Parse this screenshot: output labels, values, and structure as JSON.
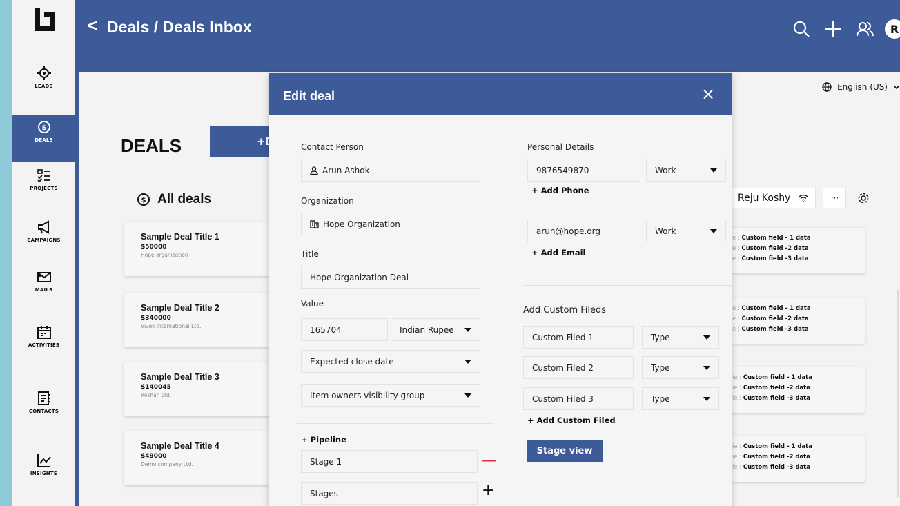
{
  "header": {
    "back_symbol": "<",
    "breadcrumb": "Deals / Deals Inbox"
  },
  "header_icons": [
    "search-icon",
    "plus-icon",
    "users-icon"
  ],
  "user": {
    "initial": "R"
  },
  "sidebar": {
    "items": [
      {
        "label": "LEADS",
        "icon": "target-icon"
      },
      {
        "label": "DEALS",
        "icon": "dollar-coin-icon",
        "active": true
      },
      {
        "label": "PROJECTS",
        "icon": "checklist-icon"
      },
      {
        "label": "CAMPAIGNS",
        "icon": "megaphone-icon"
      },
      {
        "label": "MAILS",
        "icon": "mail-icon"
      },
      {
        "label": "ACTIVITIES",
        "icon": "calendar-icon"
      },
      {
        "label": "CONTACTS",
        "icon": "contact-book-icon"
      },
      {
        "label": "INSIGHTS",
        "icon": "chart-icon"
      }
    ]
  },
  "language": "English (US)",
  "page": {
    "title": "DEALS",
    "add_button": "+D",
    "list_title": "All deals",
    "owner": "Reju Koshy",
    "more": "···"
  },
  "deals": [
    {
      "title": "Sample Deal Title 1",
      "value": "$50000",
      "org": "Hope organization"
    },
    {
      "title": "Sample Deal Title 2",
      "value": "$340000",
      "org": "Vivek International Ltd."
    },
    {
      "title": "Sample Deal Title 3",
      "value": "$140045",
      "org": "Roshan Ltd."
    },
    {
      "title": "Sample Deal Title 4",
      "value": "$49000",
      "org": "Demo company Ltd."
    }
  ],
  "custom_field_cards": [
    {
      "prefix": "e",
      "lines": [
        "Custom field - 1 data",
        "Custom field -2 data",
        "Custom field -3 data"
      ]
    },
    {
      "prefix": "e",
      "lines": [
        "Custom field - 1 data",
        "Custom field -2 data",
        "Custom field -3 data"
      ]
    },
    {
      "prefix": "ie",
      "lines": [
        "Custom field - 1 data",
        "Custom field -2 data",
        "Custom field -3 data"
      ]
    },
    {
      "prefix": "ie",
      "lines": [
        "Custom field - 1 data",
        "Custom field -2 data",
        "Custom field -3 data"
      ]
    }
  ],
  "modal": {
    "title": "Edit deal",
    "close": "×",
    "contact_label": "Contact Person",
    "contact_value": "Arun Ashok",
    "org_label": "Organization",
    "org_value": "Hope Organization",
    "title_label": "Title",
    "title_value": "Hope Organization Deal",
    "value_label": "Value",
    "value_amount": "165704",
    "currency": "Indian Rupee",
    "close_date": "Expected close date",
    "visibility": "Item owners visibility group",
    "pipeline_link": "+ Pipeline",
    "stage1": "Stage 1",
    "stage1_control": "—",
    "stages": "Stages",
    "stages_control": "+",
    "personal_label": "Personal Details",
    "phone": "9876549870",
    "phone_type": "Work",
    "add_phone": "+ Add Phone",
    "email": "arun@hope.org",
    "email_type": "Work",
    "add_email": "+ Add Email",
    "custom_label": "Add Custom Fileds",
    "custom_fields": [
      {
        "name": "Custom Filed 1",
        "type": "Type"
      },
      {
        "name": "Custom Filed 2",
        "type": "Type"
      },
      {
        "name": "Custom Filed 3",
        "type": "Type"
      }
    ],
    "add_custom": "+ Add Custom Filed",
    "stage_view": "Stage view"
  },
  "colors": {
    "primary": "#3d5b98",
    "backdrop": "#8fcad9",
    "danger": "#e0333a"
  }
}
